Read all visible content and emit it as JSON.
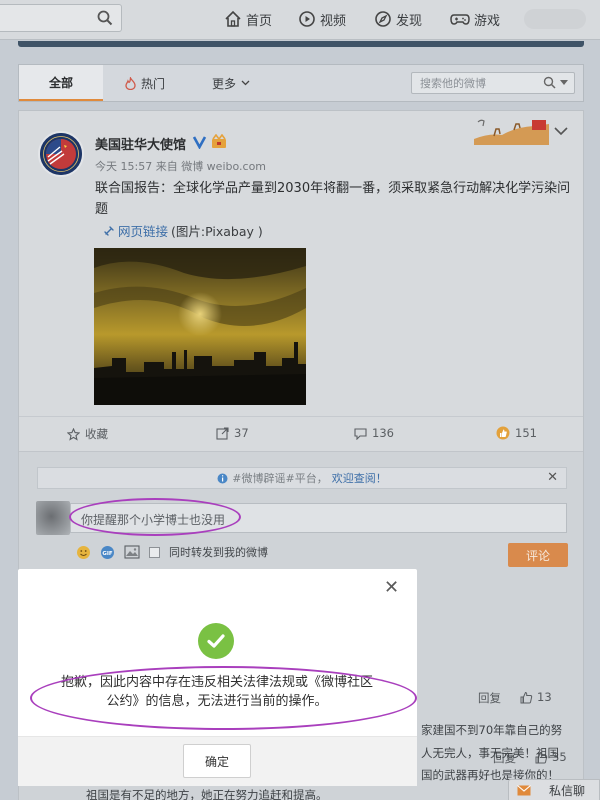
{
  "topnav": {
    "items": [
      {
        "label": "首页",
        "icon": "home-icon"
      },
      {
        "label": "视频",
        "icon": "video-icon"
      },
      {
        "label": "发现",
        "icon": "discover-icon"
      },
      {
        "label": "游戏",
        "icon": "game-icon"
      }
    ]
  },
  "tabs": {
    "all": "全部",
    "hot": "热门",
    "more": "更多",
    "search_placeholder": "搜索他的微博"
  },
  "post": {
    "username": "美国驻华大使馆",
    "meta": "今天 15:57 来自 微博 weibo.com",
    "text": "联合国报告：全球化学品产量到2030年将翻一番，须采取紧急行动解决化学污染问题",
    "link_label": "网页链接",
    "link_suffix": "(图片:Pixabay )",
    "actions": {
      "favorite": "收藏",
      "repost": "37",
      "comment": "136",
      "like": "151"
    }
  },
  "comment_box": {
    "notice_prefix": "#微博辟谣#平台，",
    "notice_link": "欢迎查阅！",
    "input_text": "你提醒那个小学博士也没用",
    "sync_label": "同时转发到我的微博",
    "submit_label": "评论"
  },
  "background_comments": {
    "reply_label": "回复",
    "likes_1": "35",
    "likes_2": "13",
    "text_1": "家建国不到70年靠自己的努",
    "text_2": "人无完人，事无完美！祖国",
    "text_3": "国的武器再好也是接你的！",
    "text_4": "祖国是有不足的地方，她正在努力追赶和提高。"
  },
  "dialog": {
    "message": "抱歉，因此内容中存在违反相关法律法规或《微博社区公约》的信息，无法进行当前的操作。",
    "confirm_label": "确定"
  },
  "dm": {
    "label": "私信聊"
  },
  "colors": {
    "accent_orange": "#d98a4c",
    "link_blue": "#3e6fa8",
    "success_green": "#7ac143",
    "annotation_purple": "#a93fbd"
  }
}
